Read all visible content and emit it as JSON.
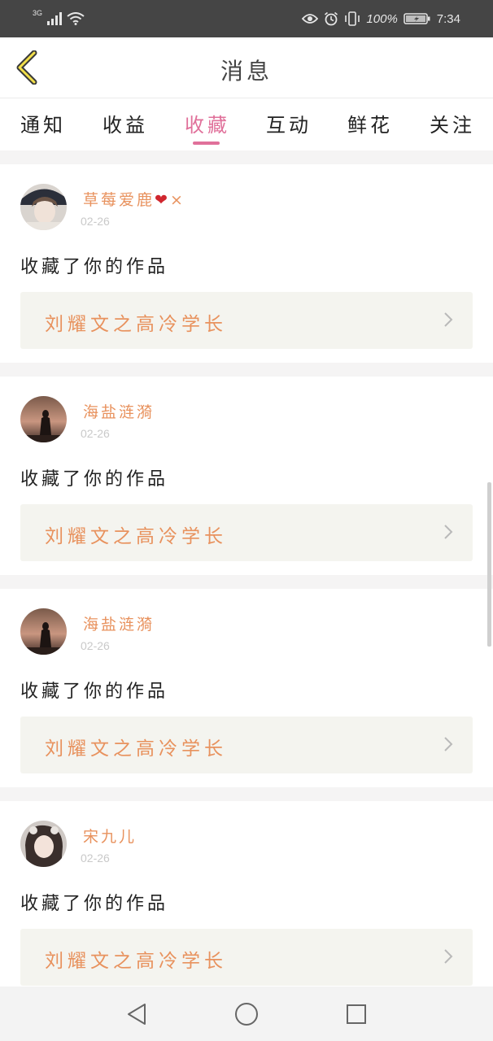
{
  "status_bar": {
    "network": "3G",
    "battery_percent": "100%",
    "time": "7:34",
    "icons": [
      "signal-icon",
      "wifi-icon",
      "eye-icon",
      "alarm-icon",
      "vibrate-icon",
      "battery-icon"
    ]
  },
  "header": {
    "title": "消息",
    "back_icon": "chevron-left-icon"
  },
  "tabs": [
    {
      "label": "通知",
      "active": false
    },
    {
      "label": "收益",
      "active": false
    },
    {
      "label": "收藏",
      "active": true
    },
    {
      "label": "互动",
      "active": false
    },
    {
      "label": "鲜花",
      "active": false
    },
    {
      "label": "关注",
      "active": false
    }
  ],
  "notifications": [
    {
      "user": "草莓爱鹿",
      "user_suffix": "❤×",
      "date": "02-26",
      "action": "收藏了你的作品",
      "work_title": "刘耀文之高冷学长"
    },
    {
      "user": "海盐涟漪",
      "user_suffix": "",
      "date": "02-26",
      "action": "收藏了你的作品",
      "work_title": "刘耀文之高冷学长"
    },
    {
      "user": "海盐涟漪",
      "user_suffix": "",
      "date": "02-26",
      "action": "收藏了你的作品",
      "work_title": "刘耀文之高冷学长"
    },
    {
      "user": "宋九儿",
      "user_suffix": "",
      "date": "02-26",
      "action": "收藏了你的作品",
      "work_title": "刘耀文之高冷学长"
    }
  ],
  "colors": {
    "accent": "#e0709a",
    "username": "#e8925e",
    "status_bar_bg": "#454545",
    "work_bg": "#f4f4ef"
  },
  "nav_icons": [
    "back-triangle-icon",
    "home-circle-icon",
    "recents-square-icon"
  ]
}
